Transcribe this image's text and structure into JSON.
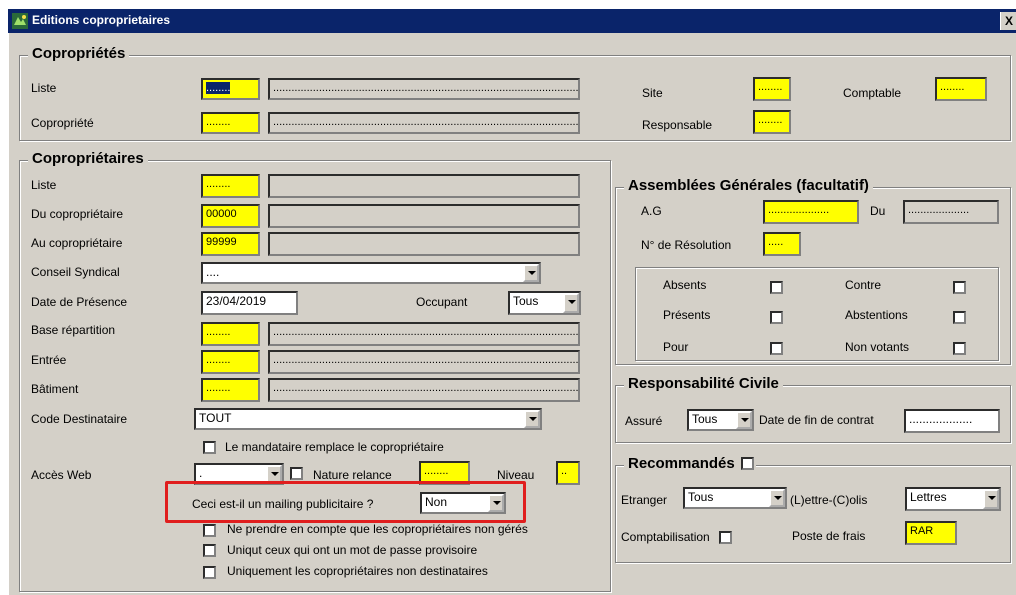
{
  "window": {
    "title": "Editions coproprietaires",
    "close_label": "X"
  },
  "copro": {
    "title": "Copropriétés",
    "liste_label": "Liste",
    "liste_value": "........",
    "liste_desc": "....................................................................................................",
    "copropriete_label": "Copropriété",
    "copropriete_value": "........",
    "copropriete_desc": "....................................................................................................",
    "site_label": "Site",
    "site_value": "........",
    "comptable_label": "Comptable",
    "comptable_value": "........",
    "responsable_label": "Responsable",
    "responsable_value": "........"
  },
  "coprop": {
    "title": "Copropriétaires",
    "liste_label": "Liste",
    "liste_value": "........",
    "du_label": "Du copropriétaire",
    "du_value": "00000",
    "au_label": "Au copropriétaire",
    "au_value": "99999",
    "conseil_label": "Conseil Syndical",
    "conseil_value": "....",
    "date_label": "Date de  Présence",
    "date_value": "23/04/2019",
    "occupant_label": "Occupant",
    "occupant_value": "Tous",
    "base_label": "Base répartition",
    "base_value": "........",
    "base_desc": "....................................................................................................",
    "entree_label": "Entrée",
    "entree_value": "........",
    "entree_desc": "....................................................................................................",
    "batiment_label": "Bâtiment",
    "batiment_value": "........",
    "batiment_desc": "....................................................................................................",
    "code_dest_label": "Code Destinataire",
    "code_dest_value": "TOUT",
    "mandataire_label": "Le mandataire remplace le copropriétaire",
    "acces_web_label": "Accès Web",
    "acces_web_value": ".",
    "nature_relance_label": "Nature relance",
    "nature_relance_value": "........",
    "niveau_label": "Niveau",
    "niveau_value": "..",
    "mailing_label": "Ceci est-il un mailing publicitaire ?",
    "mailing_value": "Non",
    "non_geres_label": "Ne prendre en compte que les copropriétaires non gérés",
    "mdp_label": "Uniqut ceux qui ont un mot de passe provisoire",
    "non_dest_label": "Uniquement les copropriétaires non destinataires"
  },
  "ag": {
    "title": "Assemblées Générales (facultatif)",
    "ag_label": "A.G",
    "ag_value": "....................",
    "du_label": "Du",
    "du_value": "....................",
    "resolution_label": "N° de Résolution",
    "resolution_value": ".....",
    "absents": "Absents",
    "presents": "Présents",
    "pour": "Pour",
    "contre": "Contre",
    "abstentions": "Abstentions",
    "non_votants": "Non votants"
  },
  "rc": {
    "title": "Responsabilité Civile",
    "assure_label": "Assuré",
    "assure_value": "Tous",
    "date_fin_label": "Date de fin de contrat",
    "date_fin_value": "..................."
  },
  "rec": {
    "title": "Recommandés",
    "etranger_label": "Etranger",
    "etranger_value": "Tous",
    "lettre_colis_label": "(L)ettre-(C)olis",
    "lettre_colis_value": "Lettres",
    "comptabilisation_label": "Comptabilisation",
    "poste_frais_label": "Poste de frais",
    "poste_frais_value": "RAR"
  },
  "colors": {
    "title_bar": "#0a246a",
    "yellow_field": "#ffff00",
    "highlight": "#e01e1e",
    "face": "#d4d0c8"
  }
}
